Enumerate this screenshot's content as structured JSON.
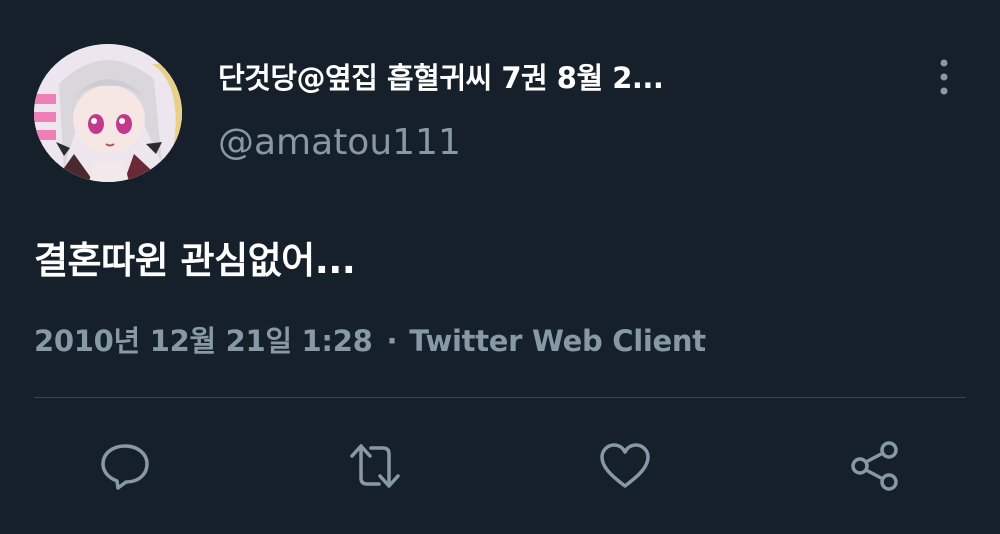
{
  "tweet": {
    "author": {
      "display_name": "단것당@옆집 흡혈귀씨 7권 8월 2...",
      "handle": "@amatou111",
      "avatar_icon": "avatar-anime-girl"
    },
    "text": "결혼따윈 관심없어...",
    "meta": {
      "timestamp": "2010년 12월 21일 1:28",
      "separator": "·",
      "source": "Twitter Web Client"
    },
    "actions": [
      {
        "name": "reply",
        "icon": "comment-icon"
      },
      {
        "name": "retweet",
        "icon": "retweet-icon"
      },
      {
        "name": "like",
        "icon": "heart-icon"
      },
      {
        "name": "share",
        "icon": "share-icon"
      }
    ],
    "more_icon": "more-vertical-icon"
  },
  "colors": {
    "background": "#15202b",
    "primary_text": "#ffffff",
    "secondary_text": "#8899a6",
    "divider": "#38444d"
  }
}
